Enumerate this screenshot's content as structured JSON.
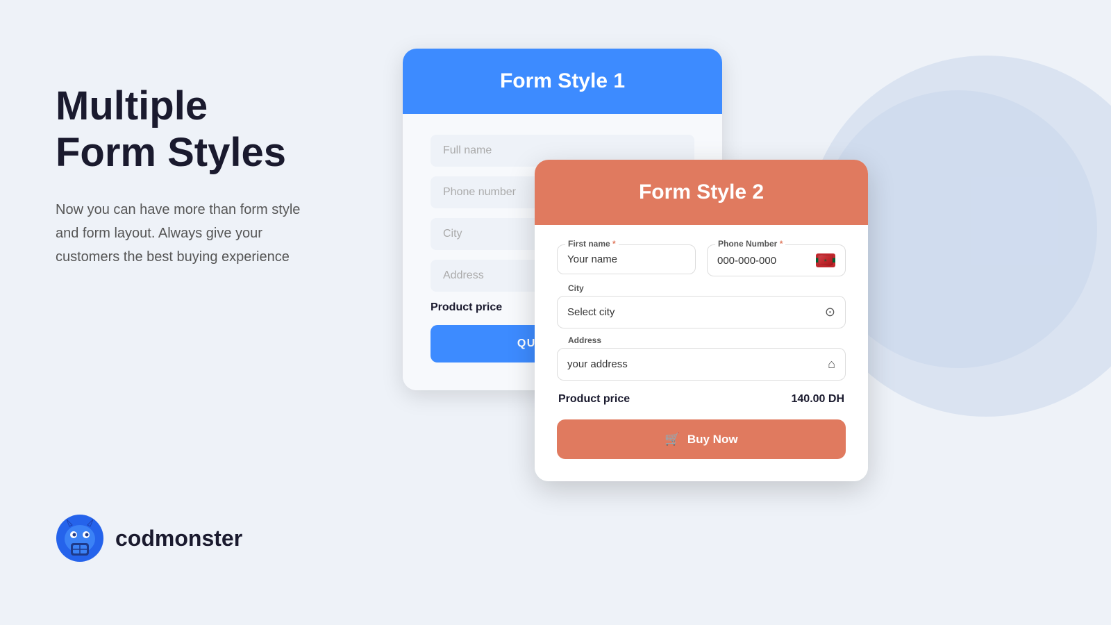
{
  "background_color": "#eef2f8",
  "left_panel": {
    "title_line1": "Multiple",
    "title_line2": "Form Styles",
    "subtitle": "Now you can have more than form style and form layout. Always give your customers the best buying experience"
  },
  "logo": {
    "text": "codmonster"
  },
  "card1": {
    "header_title": "Form Style 1",
    "fields": {
      "full_name_placeholder": "Full name",
      "phone_placeholder": "Phone number",
      "city_placeholder": "City",
      "address_placeholder": "Address"
    },
    "price_label": "Product price",
    "button_label": "QUICK ORDER",
    "header_color": "#3d8bff"
  },
  "card2": {
    "header_title": "Form Style 2",
    "header_color": "#e07a5f",
    "first_name_label": "First name",
    "first_name_required": "*",
    "first_name_placeholder": "Your name",
    "phone_label": "Phone Number",
    "phone_required": "*",
    "phone_placeholder": "000-000-000",
    "city_label": "City",
    "city_placeholder": "Select city",
    "address_label": "Address",
    "address_placeholder": "your address",
    "price_label": "Product price",
    "price_value": "140.00 DH",
    "button_label": "Buy Now",
    "button_icon": "🛒"
  }
}
